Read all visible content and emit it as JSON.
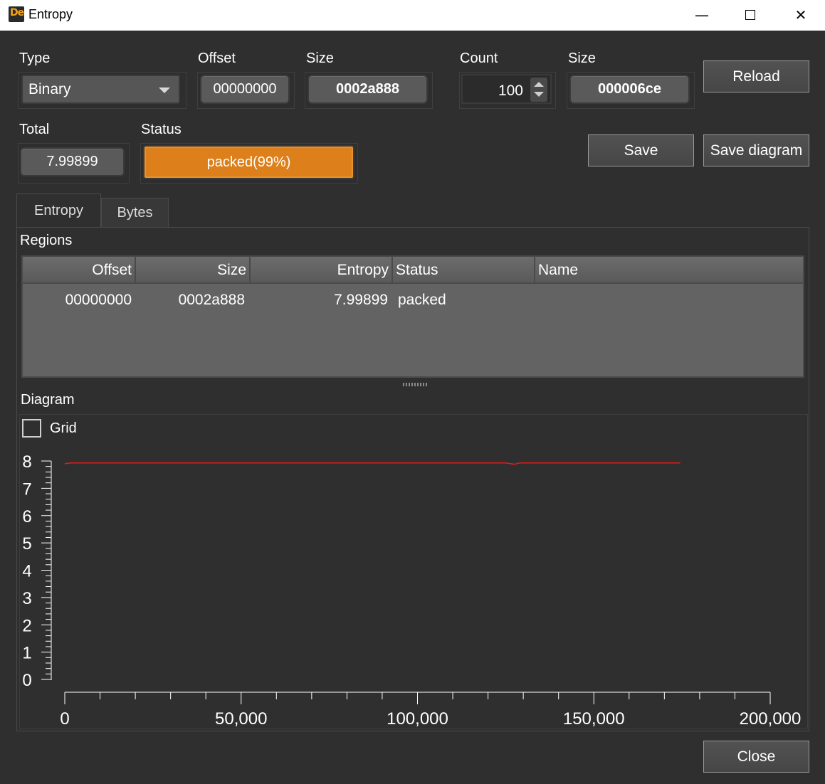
{
  "window": {
    "title": "Entropy",
    "minimize": "—",
    "close": "✕"
  },
  "app_icon": {
    "text": "De"
  },
  "top": {
    "type_label": "Type",
    "type_value": "Binary",
    "offset_label": "Offset",
    "offset_value": "00000000",
    "size_label": "Size",
    "size_value": "0002a888",
    "count_label": "Count",
    "count_value": "100",
    "size2_label": "Size",
    "size2_value": "000006ce",
    "reload_label": "Reload",
    "total_label": "Total",
    "total_value": "7.99899",
    "status_label": "Status",
    "status_value": "packed(99%)",
    "status_fraction": 0.99,
    "save_label": "Save",
    "save_diagram_label": "Save diagram"
  },
  "tabs": [
    {
      "label": "Entropy",
      "active": true
    },
    {
      "label": "Bytes",
      "active": false
    }
  ],
  "regions": {
    "title": "Regions",
    "columns": [
      "Offset",
      "Size",
      "Entropy",
      "Status",
      "Name"
    ],
    "rows": [
      {
        "offset": "00000000",
        "size": "0002a888",
        "entropy": "7.99899",
        "status": "packed",
        "name": ""
      }
    ]
  },
  "diagram": {
    "title": "Diagram",
    "grid_label": "Grid",
    "grid_checked": false
  },
  "close_label": "Close",
  "colors": {
    "background": "#2f2f2f",
    "status_packed": "#dd7f1a",
    "line": "#e01a1a"
  },
  "chart_data": {
    "type": "line",
    "xlim": [
      0,
      200000
    ],
    "ylim": [
      0,
      8
    ],
    "x_ticks": [
      0,
      50000,
      100000,
      150000,
      200000
    ],
    "x_tick_labels": [
      "0",
      "50,000",
      "100,000",
      "150,000",
      "200,000"
    ],
    "y_ticks": [
      0,
      1,
      2,
      3,
      4,
      5,
      6,
      7,
      8
    ],
    "y_tick_labels": [
      "0",
      "1",
      "2",
      "3",
      "4",
      "5",
      "6",
      "7",
      "8"
    ],
    "grid": false,
    "series": [
      {
        "x": [
          0,
          1742,
          10000,
          50000,
          100000,
          125000,
          127400,
          129000,
          140000,
          174500
        ],
        "y": [
          7.9,
          7.93,
          7.93,
          7.93,
          7.93,
          7.93,
          7.88,
          7.93,
          7.93,
          7.93
        ]
      }
    ]
  }
}
